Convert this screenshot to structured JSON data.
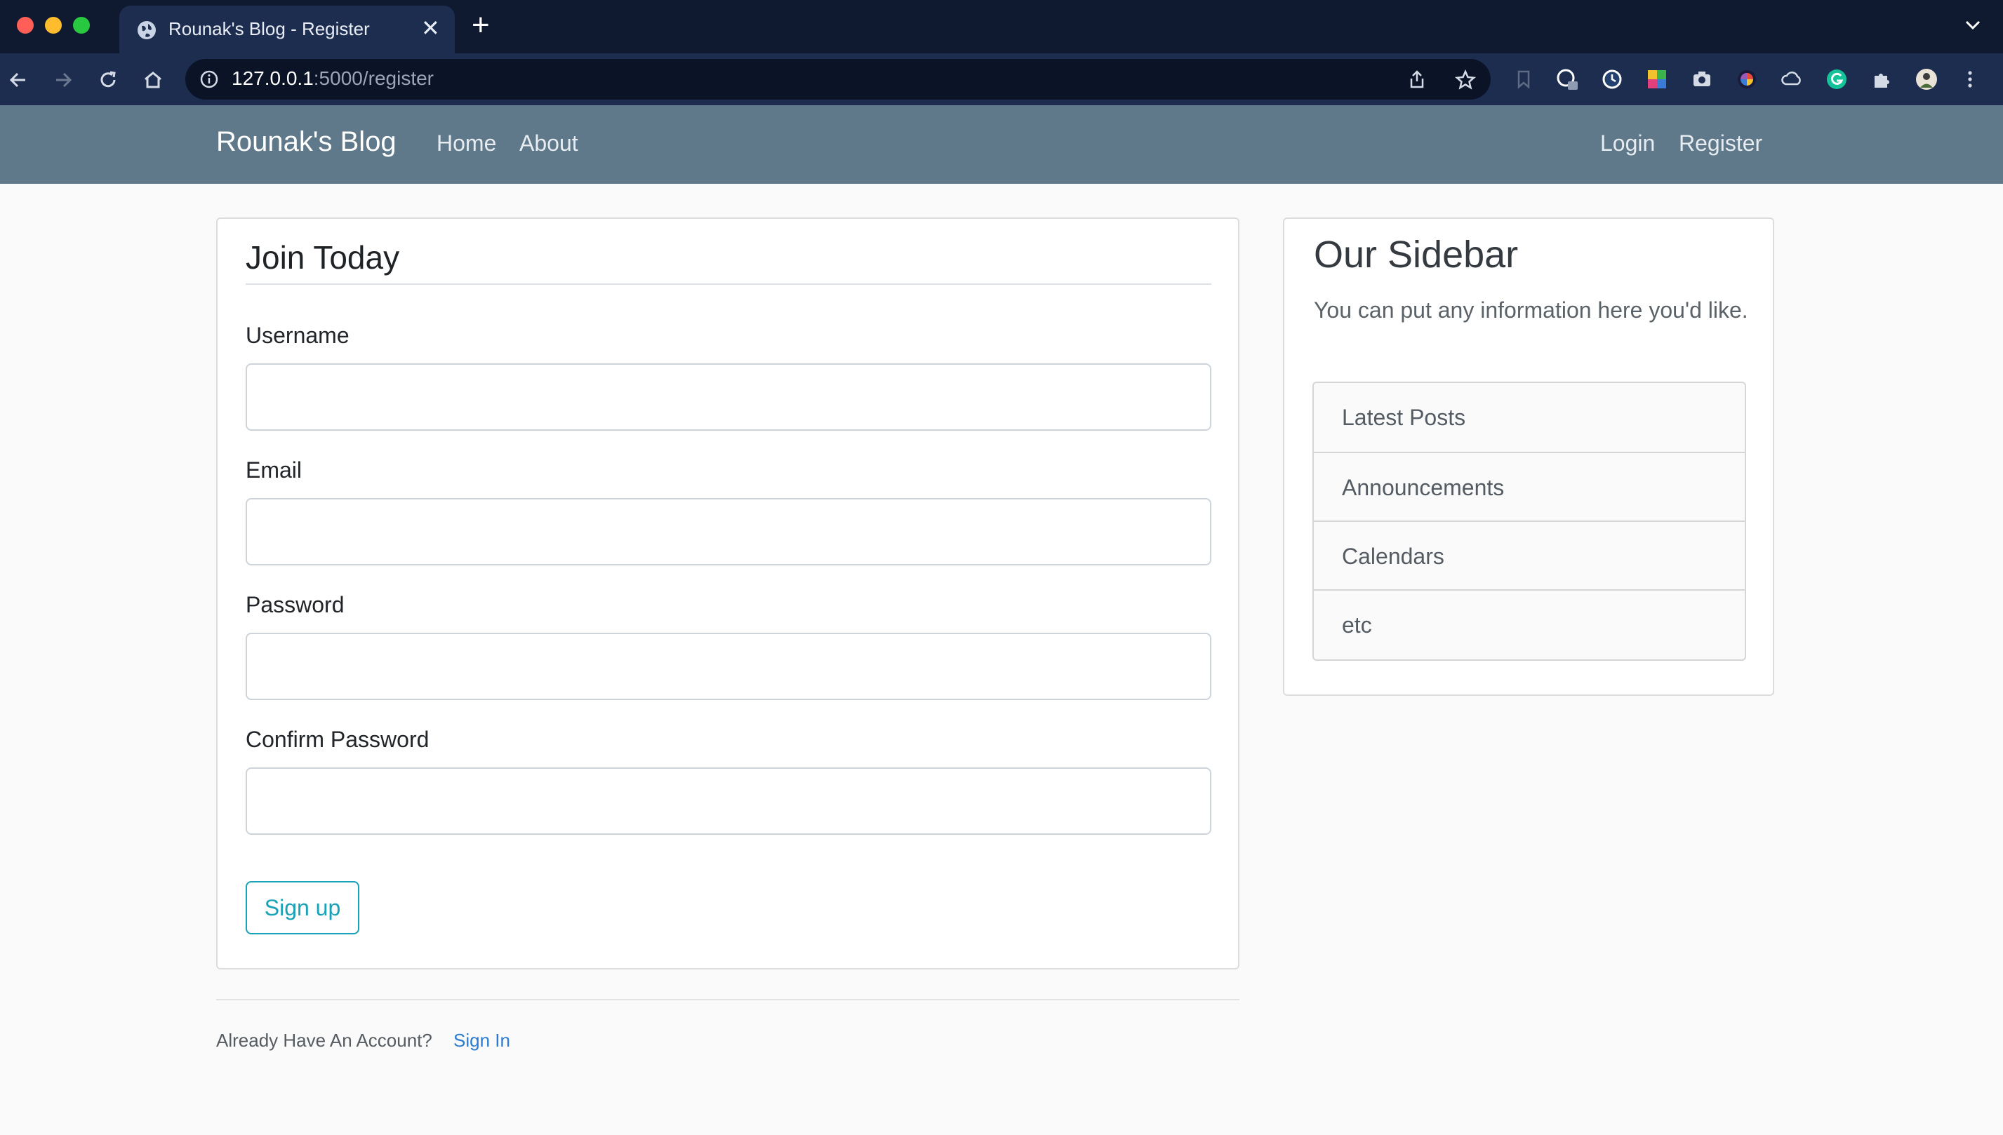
{
  "browser": {
    "tab_title": "Rounak's Blog - Register",
    "url_host": "127.0.0.1",
    "url_rest": ":5000/register"
  },
  "nav": {
    "brand": "Rounak's Blog",
    "left_links": [
      "Home",
      "About"
    ],
    "right_links": [
      "Login",
      "Register"
    ]
  },
  "form": {
    "legend": "Join Today",
    "fields": [
      {
        "label": "Username",
        "value": ""
      },
      {
        "label": "Email",
        "value": ""
      },
      {
        "label": "Password",
        "value": ""
      },
      {
        "label": "Confirm Password",
        "value": ""
      }
    ],
    "submit_label": "Sign up"
  },
  "footer": {
    "prompt": "Already Have An Account?",
    "link": "Sign In"
  },
  "sidebar": {
    "title": "Our Sidebar",
    "text": "You can put any information here you'd like.",
    "items": [
      "Latest Posts",
      "Announcements",
      "Calendars",
      "etc"
    ]
  },
  "colors": {
    "navbar": "#5f788a",
    "accent_button": "#17a2b8",
    "link": "#2a7bd1"
  }
}
